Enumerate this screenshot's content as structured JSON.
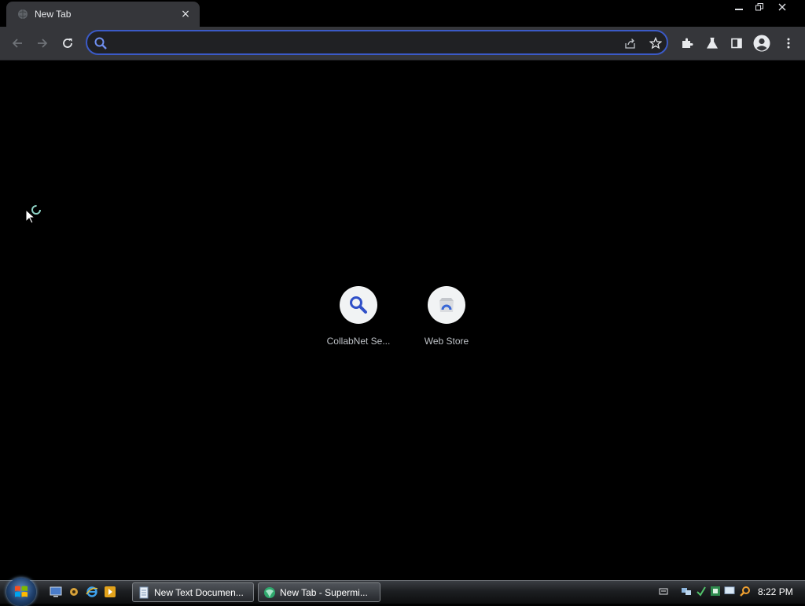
{
  "tab": {
    "title": "New Tab",
    "close_label": "×"
  },
  "window_controls": {
    "minimize": "–",
    "restore": "❐",
    "close": "✕"
  },
  "omnibox": {
    "value": "",
    "placeholder": ""
  },
  "shortcuts": [
    {
      "label": "CollabNet Se...",
      "icon": "search-icon"
    },
    {
      "label": "Web Store",
      "icon": "web-store-icon"
    }
  ],
  "taskbar": {
    "items": [
      {
        "label": "New Text Documen...",
        "icon": "notepad-icon"
      },
      {
        "label": "New Tab - Supermi...",
        "icon": "browser-icon"
      }
    ],
    "clock": "8:22 PM"
  },
  "colors": {
    "accent": "#3b5ac7",
    "toolbar": "#35363a",
    "tab": "#35363a",
    "content_bg": "#000000"
  }
}
